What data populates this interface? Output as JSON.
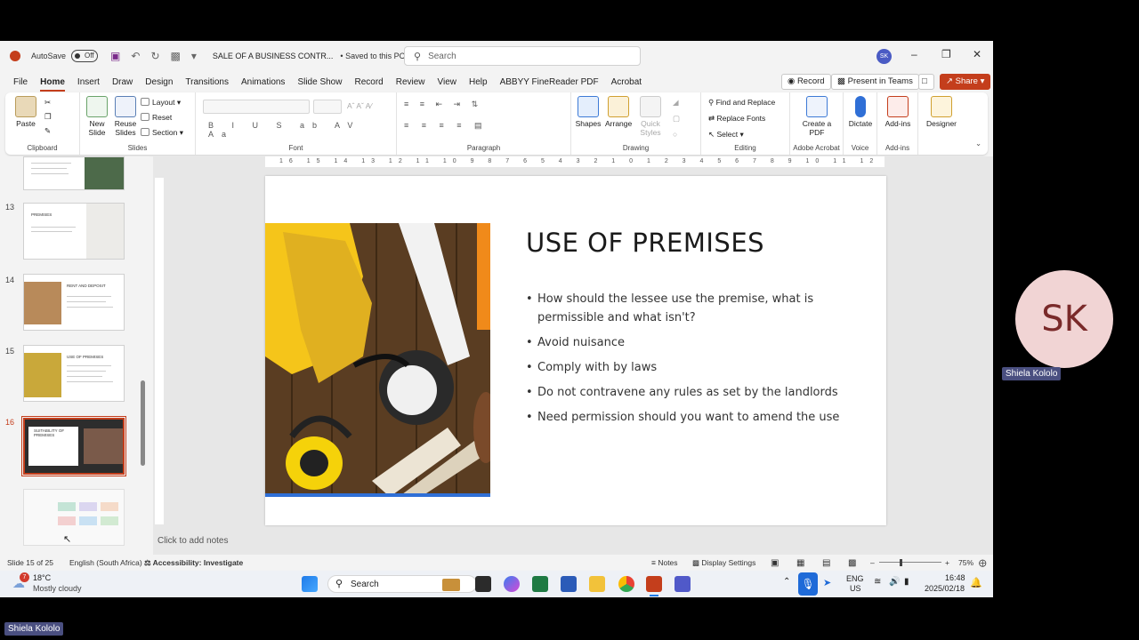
{
  "titlebar": {
    "autosave_label": "AutoSave",
    "autosave_state": "Off",
    "doc_title": "SALE OF A BUSINESS CONTR...",
    "saved_status": "• Saved to this PC",
    "search_placeholder": "Search",
    "user_initials": "SK"
  },
  "menu": {
    "items": [
      "File",
      "Home",
      "Insert",
      "Draw",
      "Design",
      "Transitions",
      "Animations",
      "Slide Show",
      "Record",
      "Review",
      "View",
      "Help",
      "ABBYY FineReader PDF",
      "Acrobat"
    ],
    "active": "Home",
    "record_btn": "Record",
    "present_btn": "Present in Teams",
    "share_btn": "Share"
  },
  "ribbon": {
    "clipboard": {
      "paste": "Paste",
      "label": "Clipboard"
    },
    "slides": {
      "new_slide": "New Slide",
      "reuse_slides": "Reuse Slides",
      "layout": "Layout",
      "reset": "Reset",
      "section": "Section",
      "label": "Slides"
    },
    "font": {
      "label": "Font"
    },
    "paragraph": {
      "label": "Paragraph"
    },
    "drawing": {
      "shapes": "Shapes",
      "arrange": "Arrange",
      "quick_styles": "Quick Styles",
      "label": "Drawing"
    },
    "editing": {
      "find_replace": "Find and Replace",
      "replace_fonts": "Replace Fonts",
      "select": "Select",
      "label": "Editing"
    },
    "acrobat": {
      "create_pdf": "Create a PDF",
      "label": "Adobe Acrobat"
    },
    "voice": {
      "dictate": "Dictate",
      "label": "Voice"
    },
    "addins": {
      "addins": "Add-ins",
      "label": "Add-ins"
    },
    "designer": {
      "designer": "Designer"
    }
  },
  "thumbnails": [
    {
      "num": "",
      "title": ""
    },
    {
      "num": "13",
      "title": "PREMISES"
    },
    {
      "num": "14",
      "title": "RENT AND DEPOSIT"
    },
    {
      "num": "15",
      "title": "USE OF PREMISES"
    },
    {
      "num": "16",
      "title": "SUITABILITY OF PREMISES"
    },
    {
      "num": "17",
      "title": ""
    }
  ],
  "ruler_labels": "16 15 14 13 12 11 10 9 8 7 6 5 4 3 2 1 0 1 2 3 4 5 6 7 8 9 10 11 12 13 14 15 16",
  "slide": {
    "title": "USE OF PREMISES",
    "bullets": [
      "How should the lessee use the premise, what is permissible and what isn't?",
      "Avoid nuisance",
      "Comply with by laws",
      "Do not contravene any rules as set by the landlords",
      "Need permission should you want to amend the use"
    ]
  },
  "notes_placeholder": "Click to add notes",
  "status": {
    "slide_of": "Slide 15 of 25",
    "language": "English (South Africa)",
    "accessibility": "Accessibility: Investigate",
    "notes": "Notes",
    "display_settings": "Display Settings",
    "zoom": "75%"
  },
  "taskbar": {
    "temp": "18°C",
    "weather": "Mostly cloudy",
    "search": "Search",
    "lang": "ENG",
    "region": "US",
    "time": "16:48",
    "date": "2025/02/18",
    "weather_badge": "7"
  },
  "participant": {
    "initials": "SK",
    "name": "Shiela Kololo",
    "self_name": "Shiela Kololo"
  },
  "colors": {
    "accent": "#c43e1c",
    "selection_blue": "#2f6fd6"
  }
}
